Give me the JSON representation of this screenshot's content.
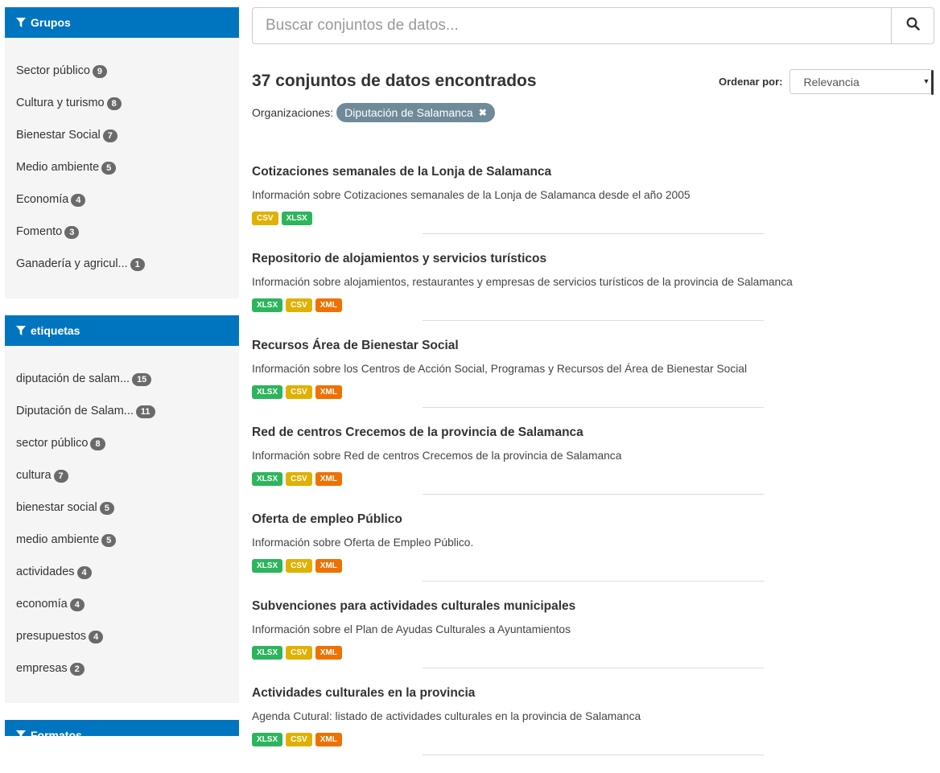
{
  "search": {
    "placeholder": "Buscar conjuntos de datos..."
  },
  "results": {
    "count_text": "37 conjuntos de datos encontrados"
  },
  "order": {
    "label": "Ordenar por:",
    "selected": "Relevancia"
  },
  "filters": {
    "label": "Organizaciones:",
    "active": "Diputación de Salamanca"
  },
  "format_colors": {
    "CSV": "#dfb100",
    "XLSX": "#2db55d",
    "XML": "#ef7100"
  },
  "facets": [
    {
      "title": "Grupos",
      "items": [
        {
          "label": "Sector público",
          "count": "9"
        },
        {
          "label": "Cultura y turismo",
          "count": "8"
        },
        {
          "label": "Bienestar Social",
          "count": "7"
        },
        {
          "label": "Medio ambiente",
          "count": "5"
        },
        {
          "label": "Economía",
          "count": "4"
        },
        {
          "label": "Fomento",
          "count": "3"
        },
        {
          "label": "Ganadería y agricul...",
          "count": "1"
        }
      ]
    },
    {
      "title": "etiquetas",
      "items": [
        {
          "label": "diputación de salam...",
          "count": "15"
        },
        {
          "label": "Diputación de Salam...",
          "count": "11"
        },
        {
          "label": "sector público",
          "count": "8"
        },
        {
          "label": "cultura",
          "count": "7"
        },
        {
          "label": "bienestar social",
          "count": "5"
        },
        {
          "label": "medio ambiente",
          "count": "5"
        },
        {
          "label": "actividades",
          "count": "4"
        },
        {
          "label": "economía",
          "count": "4"
        },
        {
          "label": "presupuestos",
          "count": "4"
        },
        {
          "label": "empresas",
          "count": "2"
        }
      ]
    },
    {
      "title": "Formatos",
      "items": []
    }
  ],
  "datasets": [
    {
      "title": "Cotizaciones semanales de la Lonja de Salamanca",
      "description": "Información sobre Cotizaciones semanales de la Lonja de Salamanca desde el año 2005",
      "formats": [
        "CSV",
        "XLSX"
      ]
    },
    {
      "title": "Repositorio de alojamientos y servicios turísticos",
      "description": "Información sobre alojamientos, restaurantes y empresas de servicios turísticos de la provincia de Salamanca",
      "formats": [
        "XLSX",
        "CSV",
        "XML"
      ]
    },
    {
      "title": "Recursos Área de Bienestar Social",
      "description": "Información sobre los Centros de Acción Social, Programas y Recursos del Área de Bienestar Social",
      "formats": [
        "XLSX",
        "CSV",
        "XML"
      ]
    },
    {
      "title": "Red de centros Crecemos de la provincia de Salamanca",
      "description": "Información sobre Red de centros Crecemos de la provincia de Salamanca",
      "formats": [
        "XLSX",
        "CSV",
        "XML"
      ]
    },
    {
      "title": "Oferta de empleo Público",
      "description": "Información sobre Oferta de Empleo Público.",
      "formats": [
        "XLSX",
        "CSV",
        "XML"
      ]
    },
    {
      "title": "Subvenciones para actividades culturales municipales",
      "description": "Información sobre el Plan de Ayudas Culturales a Ayuntamientos",
      "formats": [
        "XLSX",
        "CSV",
        "XML"
      ]
    },
    {
      "title": "Actividades culturales en la provincia",
      "description": "Agenda Cutural: listado de actividades culturales en la provincia de Salamanca",
      "formats": [
        "XLSX",
        "CSV",
        "XML"
      ]
    }
  ]
}
